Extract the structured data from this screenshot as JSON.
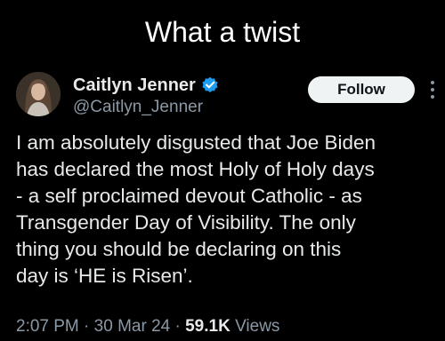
{
  "caption": "What a twist",
  "author": {
    "display_name": "Caitlyn Jenner",
    "handle": "@Caitlyn_Jenner",
    "verified_icon": "verified-badge-icon",
    "avatar_icon": "profile-photo"
  },
  "follow_label": "Follow",
  "more_icon": "more-vertical-icon",
  "tweet_lines": [
    "I am absolutely disgusted that Joe Biden",
    "has declared the most Holy of Holy days",
    "- a self proclaimed devout Catholic - as",
    "Transgender Day of Visibility. The only",
    "thing you should be declaring on this",
    "day is ‘HE is Risen’."
  ],
  "meta": {
    "time": "2:07 PM",
    "separator": "·",
    "date": "30 Mar 24",
    "views_count": "59.1K",
    "views_label": "Views"
  },
  "colors": {
    "background": "#000000",
    "text_primary": "#e7e9ea",
    "text_secondary": "#8b98a5",
    "verified_blue": "#1d9bf0",
    "follow_bg": "#eff3f4"
  }
}
